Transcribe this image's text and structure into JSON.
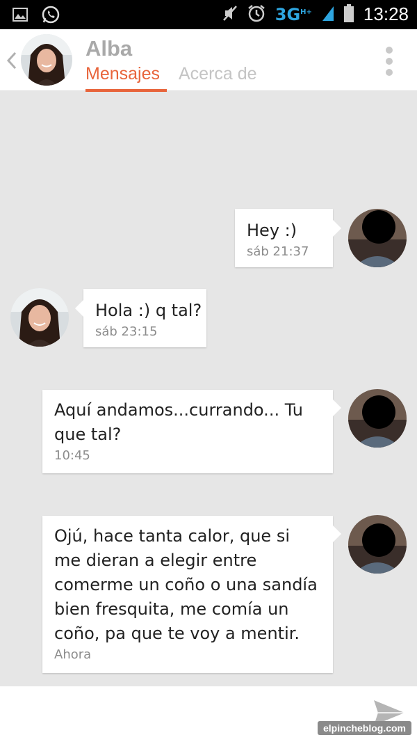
{
  "status_bar": {
    "network": "3G",
    "network_sup": "H+",
    "time": "13:28",
    "icons": [
      "gallery-icon",
      "whatsapp-icon",
      "mute-icon",
      "alarm-icon",
      "signal-icon",
      "battery-icon"
    ]
  },
  "header": {
    "contact_name": "Alba",
    "tabs": [
      {
        "label": "Mensajes",
        "active": true
      },
      {
        "label": "Acerca de",
        "active": false
      }
    ]
  },
  "messages": [
    {
      "side": "sent",
      "text": "Hey :)",
      "time": "sáb 21:37"
    },
    {
      "side": "received",
      "text": "Hola :) q tal?",
      "time": "sáb 23:15"
    },
    {
      "side": "sent",
      "text": "Aquí andamos...currando... Tu que tal?",
      "time": "10:45"
    },
    {
      "side": "sent",
      "text": "Ojú, hace tanta calor, que si me dieran a elegir entre comerme un coño o una sandía bien fresquita, me comía un coño, pa que te voy a mentir.",
      "time": "Ahora"
    }
  ],
  "watermark": "elpincheblog.com",
  "colors": {
    "accent": "#e8643b",
    "inactive_tab": "#c4c4c4",
    "name": "#a9a9a9",
    "chat_background": "#e6e6e6"
  }
}
